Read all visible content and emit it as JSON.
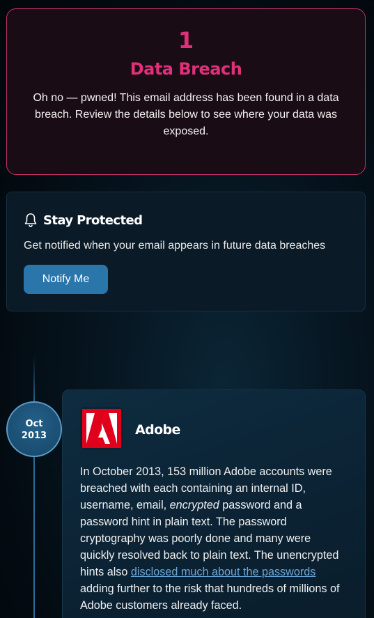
{
  "breach_summary": {
    "count": "1",
    "title": "Data Breach",
    "message": "Oh no — pwned! This email address has been found in a data breach. Review the details below to see where your data was exposed."
  },
  "notify": {
    "icon": "bell-icon",
    "title": "Stay Protected",
    "text": "Get notified when your email appears in future data breaches",
    "button_label": "Notify Me"
  },
  "timeline": {
    "entries": [
      {
        "date_month": "Oct",
        "date_year": "2013",
        "company": "Adobe",
        "logo_icon": "adobe-logo-icon",
        "description_part1": "In October 2013, 153 million Adobe accounts were breached with each containing an internal ID, username, email, ",
        "description_em": "encrypted",
        "description_part2": " password and a password hint in plain text. The password cryptography was poorly done and many were quickly resolved back to plain text. The unencrypted hints also ",
        "description_link": "disclosed much about the passwords",
        "description_part3": " adding further to the risk that hundreds of millions of Adobe customers already faced."
      }
    ]
  },
  "colors": {
    "accent_pink": "#e0307a",
    "button_blue": "#2a76aa",
    "link_blue": "#6aa6d8",
    "adobe_red": "#e0001b"
  }
}
